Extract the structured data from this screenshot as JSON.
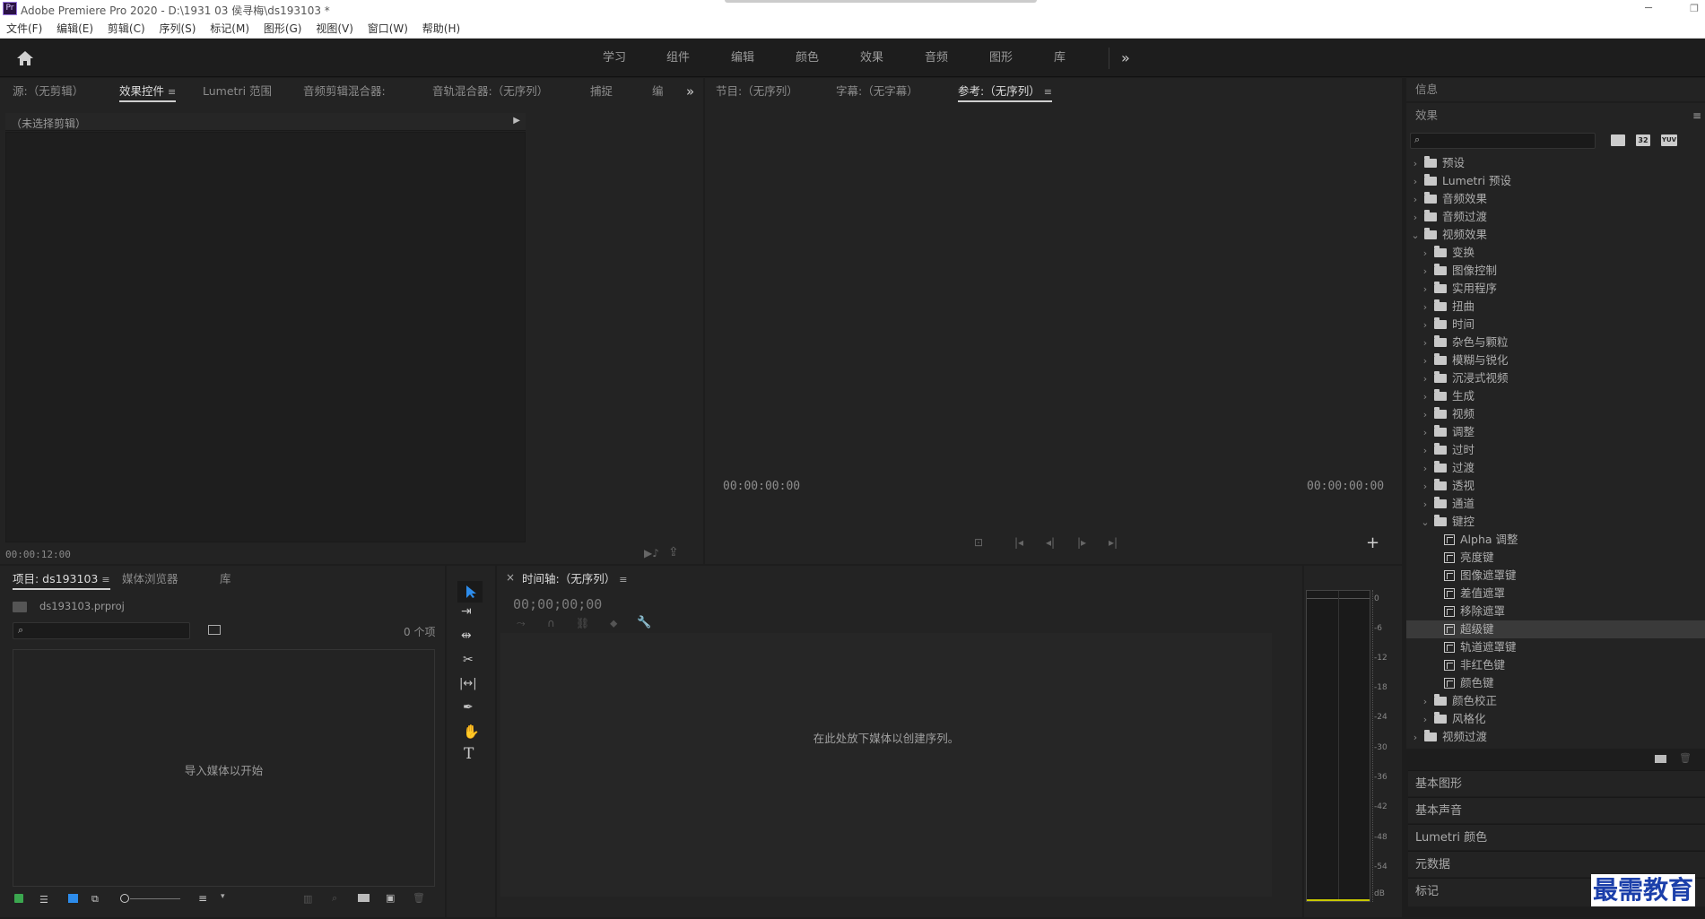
{
  "app": {
    "badge": "Pr",
    "title": "Adobe Premiere Pro 2020 - D:\\1931 03 侯寻梅\\ds193103 *",
    "window_controls": {
      "minimize": "─",
      "restore": "❐",
      "close": "✕"
    }
  },
  "menu": [
    "文件(F)",
    "编辑(E)",
    "剪辑(C)",
    "序列(S)",
    "标记(M)",
    "图形(G)",
    "视图(V)",
    "窗口(W)",
    "帮助(H)"
  ],
  "workspaces": [
    "学习",
    "组件",
    "编辑",
    "颜色",
    "效果",
    "音频",
    "图形",
    "库"
  ],
  "workspace_overflow": "»",
  "source_panel": {
    "tabs": [
      "源:（无剪辑）",
      "效果控件",
      "Lumetri 范围",
      "音频剪辑混合器:",
      "音轨混合器:（无序列）",
      "捕捉",
      "编"
    ],
    "active_tab_menu": "≡",
    "overflow": "»",
    "no_clip": "（未选择剪辑）",
    "timecode": "00:00:12:00"
  },
  "program_panel": {
    "tabs": [
      "节目:（无序列）",
      "字幕:（无字幕）",
      "参考:（无序列）"
    ],
    "active_tab_menu": "≡",
    "timecode_left": "00:00:00:00",
    "timecode_right": "00:00:00:00",
    "add": "+"
  },
  "project_panel": {
    "tabs": [
      "项目: ds193103",
      "媒体浏览器",
      "库"
    ],
    "active_tab_menu": "≡",
    "file": "ds193103.prproj",
    "item_count": "0 个项",
    "empty_message": "导入媒体以开始"
  },
  "timeline_panel": {
    "close": "×",
    "tab": "时间轴:（无序列）",
    "tab_menu": "≡",
    "timecode": "00;00;00;00",
    "drop_message": "在此处放下媒体以创建序列。"
  },
  "audio_meter": {
    "labels": [
      "0",
      "-6",
      "-12",
      "-18",
      "-24",
      "-30",
      "-36",
      "-42",
      "-48",
      "-54",
      "dB"
    ]
  },
  "right_panel": {
    "info_tab": "信息",
    "effects_tab": "效果",
    "effects_menu": "≡",
    "effect_tools": [
      "32",
      "YUV"
    ],
    "tree": [
      {
        "label": "预设",
        "level": 0,
        "icon": "preset"
      },
      {
        "label": "Lumetri 预设",
        "level": 0,
        "icon": "preset"
      },
      {
        "label": "音频效果",
        "level": 0,
        "icon": "folder"
      },
      {
        "label": "音频过渡",
        "level": 0,
        "icon": "folder"
      },
      {
        "label": "视频效果",
        "level": 0,
        "icon": "folder",
        "expanded": true
      },
      {
        "label": "变换",
        "level": 1,
        "icon": "folder"
      },
      {
        "label": "图像控制",
        "level": 1,
        "icon": "folder"
      },
      {
        "label": "实用程序",
        "level": 1,
        "icon": "folder"
      },
      {
        "label": "扭曲",
        "level": 1,
        "icon": "folder"
      },
      {
        "label": "时间",
        "level": 1,
        "icon": "folder"
      },
      {
        "label": "杂色与颗粒",
        "level": 1,
        "icon": "folder"
      },
      {
        "label": "模糊与锐化",
        "level": 1,
        "icon": "folder"
      },
      {
        "label": "沉浸式视频",
        "level": 1,
        "icon": "folder"
      },
      {
        "label": "生成",
        "level": 1,
        "icon": "folder"
      },
      {
        "label": "视频",
        "level": 1,
        "icon": "folder"
      },
      {
        "label": "调整",
        "level": 1,
        "icon": "folder"
      },
      {
        "label": "过时",
        "level": 1,
        "icon": "folder"
      },
      {
        "label": "过渡",
        "level": 1,
        "icon": "folder"
      },
      {
        "label": "透视",
        "level": 1,
        "icon": "folder"
      },
      {
        "label": "通道",
        "level": 1,
        "icon": "folder"
      },
      {
        "label": "键控",
        "level": 1,
        "icon": "folder",
        "expanded": true
      },
      {
        "label": "Alpha 调整",
        "level": 2,
        "icon": "fx"
      },
      {
        "label": "亮度键",
        "level": 2,
        "icon": "fx"
      },
      {
        "label": "图像遮罩键",
        "level": 2,
        "icon": "fx"
      },
      {
        "label": "差值遮罩",
        "level": 2,
        "icon": "fx"
      },
      {
        "label": "移除遮罩",
        "level": 2,
        "icon": "fx"
      },
      {
        "label": "超级键",
        "level": 2,
        "icon": "fx",
        "selected": true
      },
      {
        "label": "轨道遮罩键",
        "level": 2,
        "icon": "fx"
      },
      {
        "label": "非红色键",
        "level": 2,
        "icon": "fx"
      },
      {
        "label": "颜色键",
        "level": 2,
        "icon": "fx"
      },
      {
        "label": "颜色校正",
        "level": 1,
        "icon": "folder"
      },
      {
        "label": "风格化",
        "level": 1,
        "icon": "folder"
      },
      {
        "label": "视频过渡",
        "level": 0,
        "icon": "folder"
      }
    ],
    "collapsed_panels": [
      "基本图形",
      "基本声音",
      "Lumetri 颜色",
      "元数据",
      "标记"
    ]
  },
  "watermark": "最需教育",
  "colors": {
    "accent_blue": "#2d8ceb",
    "selection": "#3a3a3a",
    "meter_yellow": "#c8c800"
  }
}
